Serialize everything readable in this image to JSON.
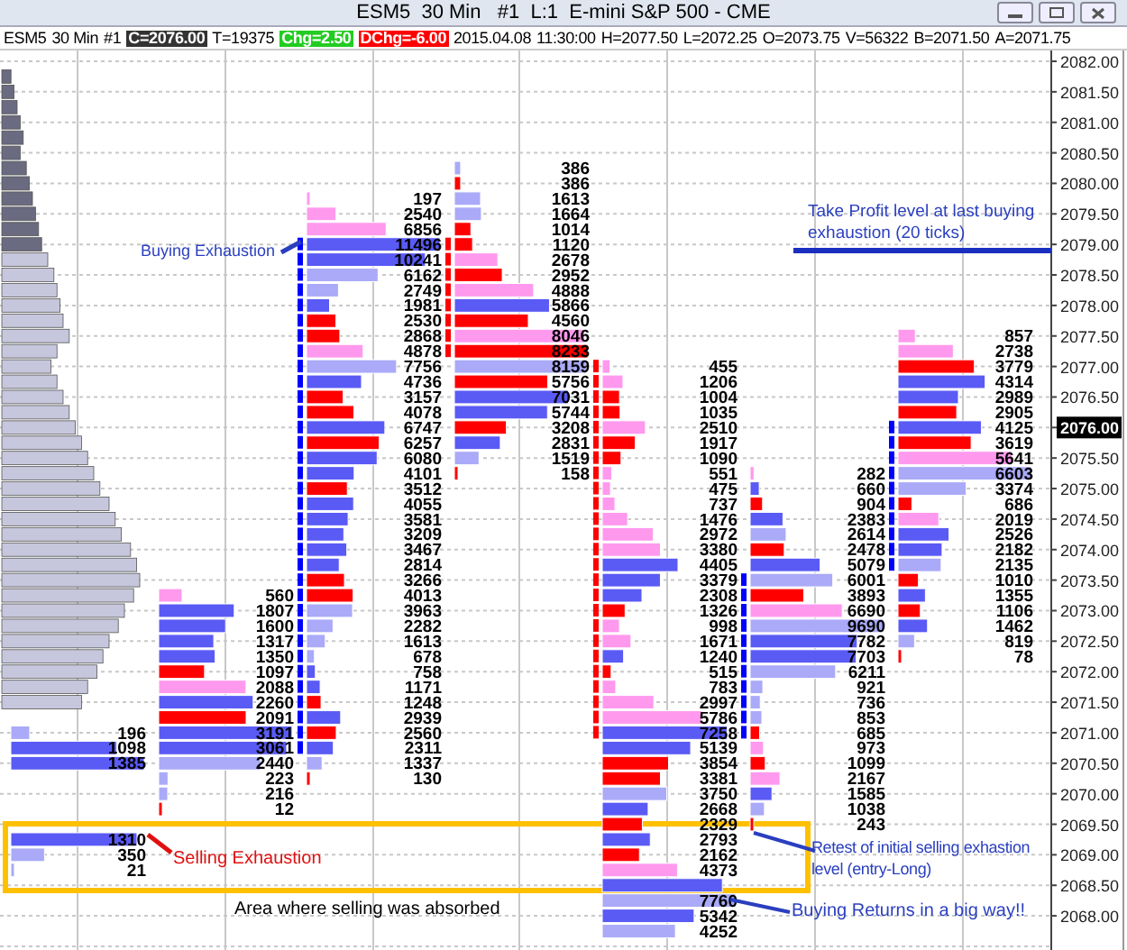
{
  "window": {
    "title": "ESM5  30 Min   #1  L:1  E-mini S&P 500 - CME"
  },
  "info_bar": [
    {
      "text": "ESM5"
    },
    {
      "text": "30 Min"
    },
    {
      "text": "#1"
    },
    {
      "text": "C=2076.00",
      "color": "#333333"
    },
    {
      "text": "T=19375"
    },
    {
      "text": "Chg=2.50",
      "color": "#22cc22"
    },
    {
      "text": "DChg=-6.00",
      "color": "#ff0000"
    },
    {
      "text": "2015.04.08"
    },
    {
      "text": "11:30:00"
    },
    {
      "text": "H=2077.50"
    },
    {
      "text": "L=2072.25"
    },
    {
      "text": "O=2073.75"
    },
    {
      "text": "V=56322"
    },
    {
      "text": "B=2071.50"
    },
    {
      "text": "A=2071.75"
    }
  ],
  "price_axis": [
    {
      "label": "2082.00",
      "current": false
    },
    {
      "label": "2081.50",
      "current": false
    },
    {
      "label": "2081.00",
      "current": false
    },
    {
      "label": "2080.50",
      "current": false
    },
    {
      "label": "2080.00",
      "current": false
    },
    {
      "label": "2079.50",
      "current": false
    },
    {
      "label": "2079.00",
      "current": false
    },
    {
      "label": "2078.50",
      "current": false
    },
    {
      "label": "2078.00",
      "current": false
    },
    {
      "label": "2077.50",
      "current": false
    },
    {
      "label": "2077.00",
      "current": false
    },
    {
      "label": "2076.50",
      "current": false
    },
    {
      "label": "2076.00",
      "current": true
    },
    {
      "label": "2075.50",
      "current": false
    },
    {
      "label": "2075.00",
      "current": false
    },
    {
      "label": "2074.50",
      "current": false
    },
    {
      "label": "2074.00",
      "current": false
    },
    {
      "label": "2073.50",
      "current": false
    },
    {
      "label": "2073.00",
      "current": false
    },
    {
      "label": "2072.50",
      "current": false
    },
    {
      "label": "2072.00",
      "current": false
    },
    {
      "label": "2071.50",
      "current": false
    },
    {
      "label": "2071.00",
      "current": false
    },
    {
      "label": "2070.50",
      "current": false
    },
    {
      "label": "2070.00",
      "current": false
    },
    {
      "label": "2069.50",
      "current": false
    },
    {
      "label": "2069.00",
      "current": false
    },
    {
      "label": "2068.50",
      "current": false
    },
    {
      "label": "2068.00",
      "current": false
    }
  ],
  "columns": [
    {
      "segments": [
        {
          "rows": [
            {
              "value": "196",
              "color": "#aaaaf8"
            },
            {
              "value": "1098",
              "color": "#5a5af5"
            },
            {
              "value": "1385",
              "color": "#5a5af5"
            }
          ]
        },
        {
          "rows": [
            {
              "value": "1310",
              "color": "#5a5af5"
            },
            {
              "value": "350",
              "color": "#aaaaf8"
            },
            {
              "value": "21",
              "color": "#aaaaf8"
            }
          ]
        }
      ]
    },
    {
      "segments": [
        {
          "rows": [
            {
              "value": "560",
              "color": "#ff99ee"
            },
            {
              "value": "1807",
              "color": "#5a5af5"
            },
            {
              "value": "1600",
              "color": "#5a5af5"
            },
            {
              "value": "1317",
              "color": "#5a5af5"
            },
            {
              "value": "1350",
              "color": "#5a5af5"
            },
            {
              "value": "1097",
              "color": "#ff0000"
            },
            {
              "value": "2088",
              "color": "#ff99ee"
            },
            {
              "value": "2260",
              "color": "#5a5af5"
            },
            {
              "value": "2091",
              "color": "#ff0000"
            },
            {
              "value": "3191",
              "color": "#5a5af5"
            },
            {
              "value": "3061",
              "color": "#5a5af5"
            },
            {
              "value": "2440",
              "color": "#aaaaf8"
            },
            {
              "value": "223",
              "color": "#aaaaf8"
            },
            {
              "value": "216",
              "color": "#aaaaf8"
            },
            {
              "value": "12",
              "color": "#ff0000"
            }
          ]
        }
      ]
    },
    {
      "color": "#0000ff",
      "segments": [
        {
          "rows": [
            {
              "value": "197",
              "color": "#ff99ee",
              "marked": false
            },
            {
              "value": "2540",
              "color": "#ff99ee",
              "marked": false
            },
            {
              "value": "6856",
              "color": "#ff99ee",
              "marked": false
            },
            {
              "value": "11496",
              "color": "#5a5af5",
              "marked": true
            },
            {
              "value": "10241",
              "color": "#5a5af5",
              "marked": true
            },
            {
              "value": "6162",
              "color": "#aaaaf8",
              "marked": true
            },
            {
              "value": "2749",
              "color": "#aaaaf8",
              "marked": true
            },
            {
              "value": "1981",
              "color": "#5a5af5",
              "marked": true
            },
            {
              "value": "2530",
              "color": "#ff0000",
              "marked": true
            },
            {
              "value": "2868",
              "color": "#ff0000",
              "marked": true
            },
            {
              "value": "4878",
              "color": "#ff99ee",
              "marked": true
            },
            {
              "value": "7756",
              "color": "#aaaaf8",
              "marked": true
            },
            {
              "value": "4736",
              "color": "#5a5af5",
              "marked": true
            },
            {
              "value": "3157",
              "color": "#ff0000",
              "marked": true
            },
            {
              "value": "4078",
              "color": "#ff0000",
              "marked": true
            },
            {
              "value": "6747",
              "color": "#5a5af5",
              "marked": true
            },
            {
              "value": "6257",
              "color": "#ff0000",
              "marked": true
            },
            {
              "value": "6080",
              "color": "#5a5af5",
              "marked": true
            },
            {
              "value": "4101",
              "color": "#5a5af5",
              "marked": true
            },
            {
              "value": "3512",
              "color": "#ff0000",
              "marked": true
            },
            {
              "value": "4055",
              "color": "#5a5af5",
              "marked": true
            },
            {
              "value": "3581",
              "color": "#5a5af5",
              "marked": true
            },
            {
              "value": "3209",
              "color": "#5a5af5",
              "marked": true
            },
            {
              "value": "3467",
              "color": "#5a5af5",
              "marked": true
            },
            {
              "value": "2814",
              "color": "#5a5af5",
              "marked": true
            },
            {
              "value": "3266",
              "color": "#ff0000",
              "marked": true
            },
            {
              "value": "4013",
              "color": "#ff0000",
              "marked": true
            },
            {
              "value": "3963",
              "color": "#aaaaf8",
              "marked": true
            },
            {
              "value": "2282",
              "color": "#aaaaf8",
              "marked": true
            },
            {
              "value": "1613",
              "color": "#aaaaf8",
              "marked": true
            },
            {
              "value": "678",
              "color": "#aaaaf8",
              "marked": true
            },
            {
              "value": "758",
              "color": "#5a5af5",
              "marked": true
            },
            {
              "value": "1171",
              "color": "#5a5af5",
              "marked": true
            },
            {
              "value": "1248",
              "color": "#ff0000",
              "marked": true
            },
            {
              "value": "2939",
              "color": "#5a5af5",
              "marked": true
            },
            {
              "value": "2560",
              "color": "#ff0000",
              "marked": true
            },
            {
              "value": "2311",
              "color": "#5a5af5",
              "marked": true
            },
            {
              "value": "1337",
              "color": "#aaaaf8",
              "marked": false
            },
            {
              "value": "130",
              "color": "#ff0000",
              "marked": false
            }
          ]
        }
      ]
    },
    {
      "color": "#ff0000",
      "segments": [
        {
          "rows": [
            {
              "value": "386",
              "color": "#aaaaf8",
              "marked": false
            },
            {
              "value": "386",
              "color": "#ff0000",
              "marked": false
            },
            {
              "value": "1613",
              "color": "#aaaaf8",
              "marked": false
            },
            {
              "value": "1664",
              "color": "#aaaaf8",
              "marked": false
            },
            {
              "value": "1014",
              "color": "#ff0000",
              "marked": false
            },
            {
              "value": "1120",
              "color": "#ff0000",
              "marked": true
            },
            {
              "value": "2678",
              "color": "#ff99ee",
              "marked": true
            },
            {
              "value": "2952",
              "color": "#ff0000",
              "marked": true
            },
            {
              "value": "4888",
              "color": "#ff99ee",
              "marked": true
            },
            {
              "value": "5866",
              "color": "#5a5af5",
              "marked": true
            },
            {
              "value": "4560",
              "color": "#ff0000",
              "marked": true
            },
            {
              "value": "8046",
              "color": "#ff99ee",
              "marked": true
            },
            {
              "value": "8233",
              "color": "#ff0000",
              "marked": true
            },
            {
              "value": "8159",
              "color": "#aaaaf8",
              "marked": false
            },
            {
              "value": "5756",
              "color": "#ff0000",
              "marked": false
            },
            {
              "value": "7031",
              "color": "#5a5af5",
              "marked": false
            },
            {
              "value": "5744",
              "color": "#5a5af5",
              "marked": false
            },
            {
              "value": "3208",
              "color": "#ff0000",
              "marked": false
            },
            {
              "value": "2831",
              "color": "#5a5af5",
              "marked": false
            },
            {
              "value": "1519",
              "color": "#aaaaf8",
              "marked": false
            },
            {
              "value": "158",
              "color": "#ff0000",
              "marked": false
            }
          ]
        }
      ]
    },
    {
      "color": "#ff0000",
      "segments": [
        {
          "rows": [
            {
              "value": "455",
              "color": "#ff99ee",
              "marked": true
            },
            {
              "value": "1206",
              "color": "#ff99ee",
              "marked": true
            },
            {
              "value": "1004",
              "color": "#ff0000",
              "marked": true
            },
            {
              "value": "1035",
              "color": "#ff0000",
              "marked": true
            },
            {
              "value": "2510",
              "color": "#ff99ee",
              "marked": true
            },
            {
              "value": "1917",
              "color": "#ff0000",
              "marked": true
            },
            {
              "value": "1090",
              "color": "#ff0000",
              "marked": true
            },
            {
              "value": "551",
              "color": "#ff99ee",
              "marked": true
            },
            {
              "value": "475",
              "color": "#ff99ee",
              "marked": true
            },
            {
              "value": "737",
              "color": "#ff99ee",
              "marked": true
            },
            {
              "value": "1476",
              "color": "#ff99ee",
              "marked": true
            },
            {
              "value": "2972",
              "color": "#ff99ee",
              "marked": true
            },
            {
              "value": "3380",
              "color": "#ff99ee",
              "marked": true
            },
            {
              "value": "4405",
              "color": "#5a5af5",
              "marked": true
            },
            {
              "value": "3379",
              "color": "#5a5af5",
              "marked": true
            },
            {
              "value": "2308",
              "color": "#5a5af5",
              "marked": true
            },
            {
              "value": "1326",
              "color": "#ff0000",
              "marked": true
            },
            {
              "value": "998",
              "color": "#ff99ee",
              "marked": true
            },
            {
              "value": "1671",
              "color": "#ff99ee",
              "marked": true
            },
            {
              "value": "1240",
              "color": "#5a5af5",
              "marked": true
            },
            {
              "value": "515",
              "color": "#ff0000",
              "marked": true
            },
            {
              "value": "783",
              "color": "#ff99ee",
              "marked": true
            },
            {
              "value": "2997",
              "color": "#ff99ee",
              "marked": true
            },
            {
              "value": "5786",
              "color": "#ff99ee",
              "marked": true
            },
            {
              "value": "7258",
              "color": "#5a5af5",
              "marked": true
            },
            {
              "value": "5139",
              "color": "#5a5af5",
              "marked": false
            },
            {
              "value": "3854",
              "color": "#ff0000",
              "marked": false
            },
            {
              "value": "3381",
              "color": "#ff0000",
              "marked": false
            },
            {
              "value": "3750",
              "color": "#aaaaf8",
              "marked": false
            },
            {
              "value": "2668",
              "color": "#5a5af5",
              "marked": false
            },
            {
              "value": "2329",
              "color": "#ff0000",
              "marked": false
            },
            {
              "value": "2793",
              "color": "#5a5af5",
              "marked": false
            },
            {
              "value": "2162",
              "color": "#ff0000",
              "marked": false
            },
            {
              "value": "4373",
              "color": "#ff99ee",
              "marked": false
            },
            {
              "color": "#5a5af5",
              "marked": false
            },
            {
              "value": "7760",
              "color": "#aaaaf8",
              "marked": false
            },
            {
              "value": "5342",
              "color": "#5a5af5",
              "marked": false
            },
            {
              "value": "4252",
              "color": "#aaaaf8",
              "marked": false
            }
          ]
        }
      ]
    },
    {
      "color": "#0000ff",
      "segments": [
        {
          "rows": [
            {
              "value": "282",
              "color": "#ff99ee",
              "marked": false
            },
            {
              "value": "660",
              "color": "#5a5af5",
              "marked": false
            },
            {
              "value": "904",
              "color": "#ff0000",
              "marked": false
            },
            {
              "value": "2383",
              "color": "#5a5af5",
              "marked": false
            },
            {
              "value": "2614",
              "color": "#aaaaf8",
              "marked": false
            },
            {
              "value": "2478",
              "color": "#ff0000",
              "marked": false
            },
            {
              "value": "5079",
              "color": "#5a5af5",
              "marked": false
            },
            {
              "value": "6001",
              "color": "#aaaaf8",
              "marked": true
            },
            {
              "value": "3893",
              "color": "#ff0000",
              "marked": true
            },
            {
              "value": "6690",
              "color": "#ff99ee",
              "marked": true
            },
            {
              "value": "9690",
              "color": "#aaaaf8",
              "marked": true
            },
            {
              "value": "7782",
              "color": "#5a5af5",
              "marked": true
            },
            {
              "value": "7703",
              "color": "#5a5af5",
              "marked": true
            },
            {
              "value": "6211",
              "color": "#aaaaf8",
              "marked": true
            },
            {
              "value": "921",
              "color": "#aaaaf8",
              "marked": true
            },
            {
              "value": "736",
              "color": "#aaaaf8",
              "marked": true
            },
            {
              "value": "853",
              "color": "#aaaaf8",
              "marked": true
            },
            {
              "value": "685",
              "color": "#ff0000",
              "marked": true
            },
            {
              "value": "973",
              "color": "#ff99ee",
              "marked": false
            },
            {
              "value": "1099",
              "color": "#ff0000",
              "marked": false
            },
            {
              "value": "2167",
              "color": "#ff99ee",
              "marked": false
            },
            {
              "value": "1585",
              "color": "#5a5af5",
              "marked": false
            },
            {
              "value": "1038",
              "color": "#aaaaf8",
              "marked": false
            },
            {
              "value": "243",
              "color": "#ff0000",
              "marked": false
            }
          ]
        }
      ]
    },
    {
      "color": "#0000ff",
      "segments": [
        {
          "rows": [
            {
              "value": "857",
              "color": "#ff99ee",
              "marked": false
            },
            {
              "value": "2738",
              "color": "#ff99ee",
              "marked": false
            },
            {
              "value": "3779",
              "color": "#ff0000",
              "marked": false
            },
            {
              "value": "4314",
              "color": "#5a5af5",
              "marked": false
            },
            {
              "value": "2989",
              "color": "#5a5af5",
              "marked": false
            },
            {
              "value": "2905",
              "color": "#ff0000",
              "marked": false
            },
            {
              "value": "4125",
              "color": "#5a5af5",
              "marked": true
            },
            {
              "value": "3619",
              "color": "#ff0000",
              "marked": true
            },
            {
              "value": "5641",
              "color": "#ff99ee",
              "marked": true
            },
            {
              "value": "6603",
              "color": "#aaaaf8",
              "marked": true
            },
            {
              "value": "3374",
              "color": "#aaaaf8",
              "marked": true
            },
            {
              "value": "686",
              "color": "#ff0000",
              "marked": true
            },
            {
              "value": "2019",
              "color": "#ff99ee",
              "marked": true
            },
            {
              "value": "2526",
              "color": "#5a5af5",
              "marked": true
            },
            {
              "value": "2182",
              "color": "#5a5af5",
              "marked": true
            },
            {
              "value": "2135",
              "color": "#aaaaf8",
              "marked": true
            },
            {
              "value": "1010",
              "color": "#ff0000",
              "marked": false
            },
            {
              "value": "1355",
              "color": "#5a5af5",
              "marked": false
            },
            {
              "value": "1106",
              "color": "#ff0000",
              "marked": false
            },
            {
              "value": "1462",
              "color": "#5a5af5",
              "marked": false
            },
            {
              "value": "819",
              "color": "#aaaaf8",
              "marked": false
            },
            {
              "value": "78",
              "color": "#ff0000",
              "marked": false
            }
          ]
        }
      ]
    }
  ],
  "notes": {
    "buying_exhaustion": "Buying Exhaustion",
    "take_profit": "Take Profit level at last buying exhaustion (20 ticks)",
    "selling_exhaustion": "Selling Exhaustion",
    "absorption_area": "Area where selling was absorbed",
    "retest": "Retest of initial selling exhastion level (entry-Long)",
    "buying_returns": "Buying Returns in a big way!!"
  }
}
